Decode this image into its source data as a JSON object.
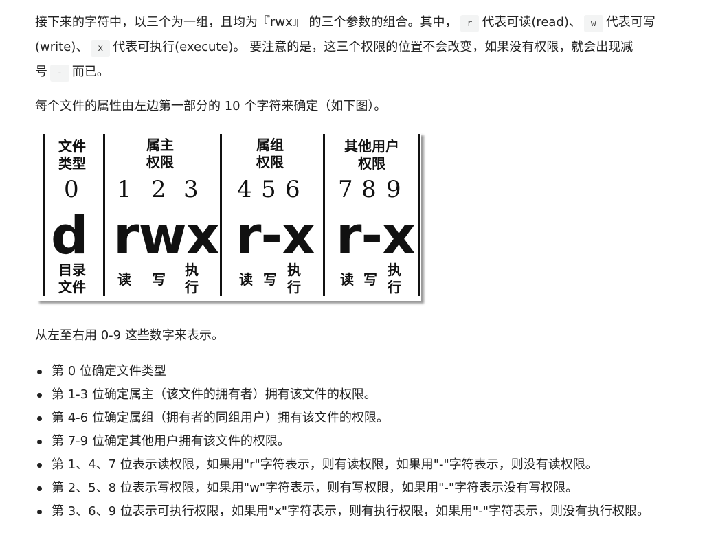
{
  "para1": {
    "t1": "接下来的字符中，以三个为一组，且均为『rwx』 的三个参数的组合。其中，",
    "c_r": "r",
    "t2": "代表可读(read)、",
    "c_w": "w",
    "t3": "代表可写(write)、",
    "c_x": "x",
    "t4": "代表可执行(execute)。 要注意的是，这三个权限的位置不会改变，如果没有权限，就会出现减号",
    "c_dash": "-",
    "t5": "而已。"
  },
  "para2": "每个文件的属性由左边第一部分的 10 个字符来确定（如下图）。",
  "figure": {
    "headers": {
      "type": [
        "文件",
        "类型"
      ],
      "owner": [
        "属主",
        "权限"
      ],
      "group": [
        "属组",
        "权限"
      ],
      "other": [
        "其他用户",
        "权限"
      ]
    },
    "numbers": {
      "n0": "0",
      "n1": "1",
      "n2": "2",
      "n3": "3",
      "n4": "4",
      "n5": "5",
      "n6": "6",
      "n7": "7",
      "n8": "8",
      "n9": "9"
    },
    "perms": {
      "type": "d",
      "owner": "rwx",
      "group": "r-x",
      "other": "r-x"
    },
    "labels": {
      "type": [
        "目录",
        "文件"
      ],
      "read": "读",
      "write": "写",
      "exec": [
        "执",
        "行"
      ]
    }
  },
  "para3": "从左至右用 0-9 这些数字来表示。",
  "list": [
    "第 0 位确定文件类型",
    "第 1-3 位确定属主（该文件的拥有者）拥有该文件的权限。",
    "第 4-6 位确定属组（拥有者的同组用户）拥有该文件的权限。",
    "第 7-9 位确定其他用户拥有该文件的权限。",
    "第 1、4、7 位表示读权限，如果用\"r\"字符表示，则有读权限，如果用\"-\"字符表示，则没有读权限。",
    "第 2、5、8 位表示写权限，如果用\"w\"字符表示，则有写权限，如果用\"-\"字符表示没有写权限。",
    "第 3、6、9 位表示可执行权限，如果用\"x\"字符表示，则有执行权限，如果用\"-\"字符表示，则没有执行权限。"
  ]
}
